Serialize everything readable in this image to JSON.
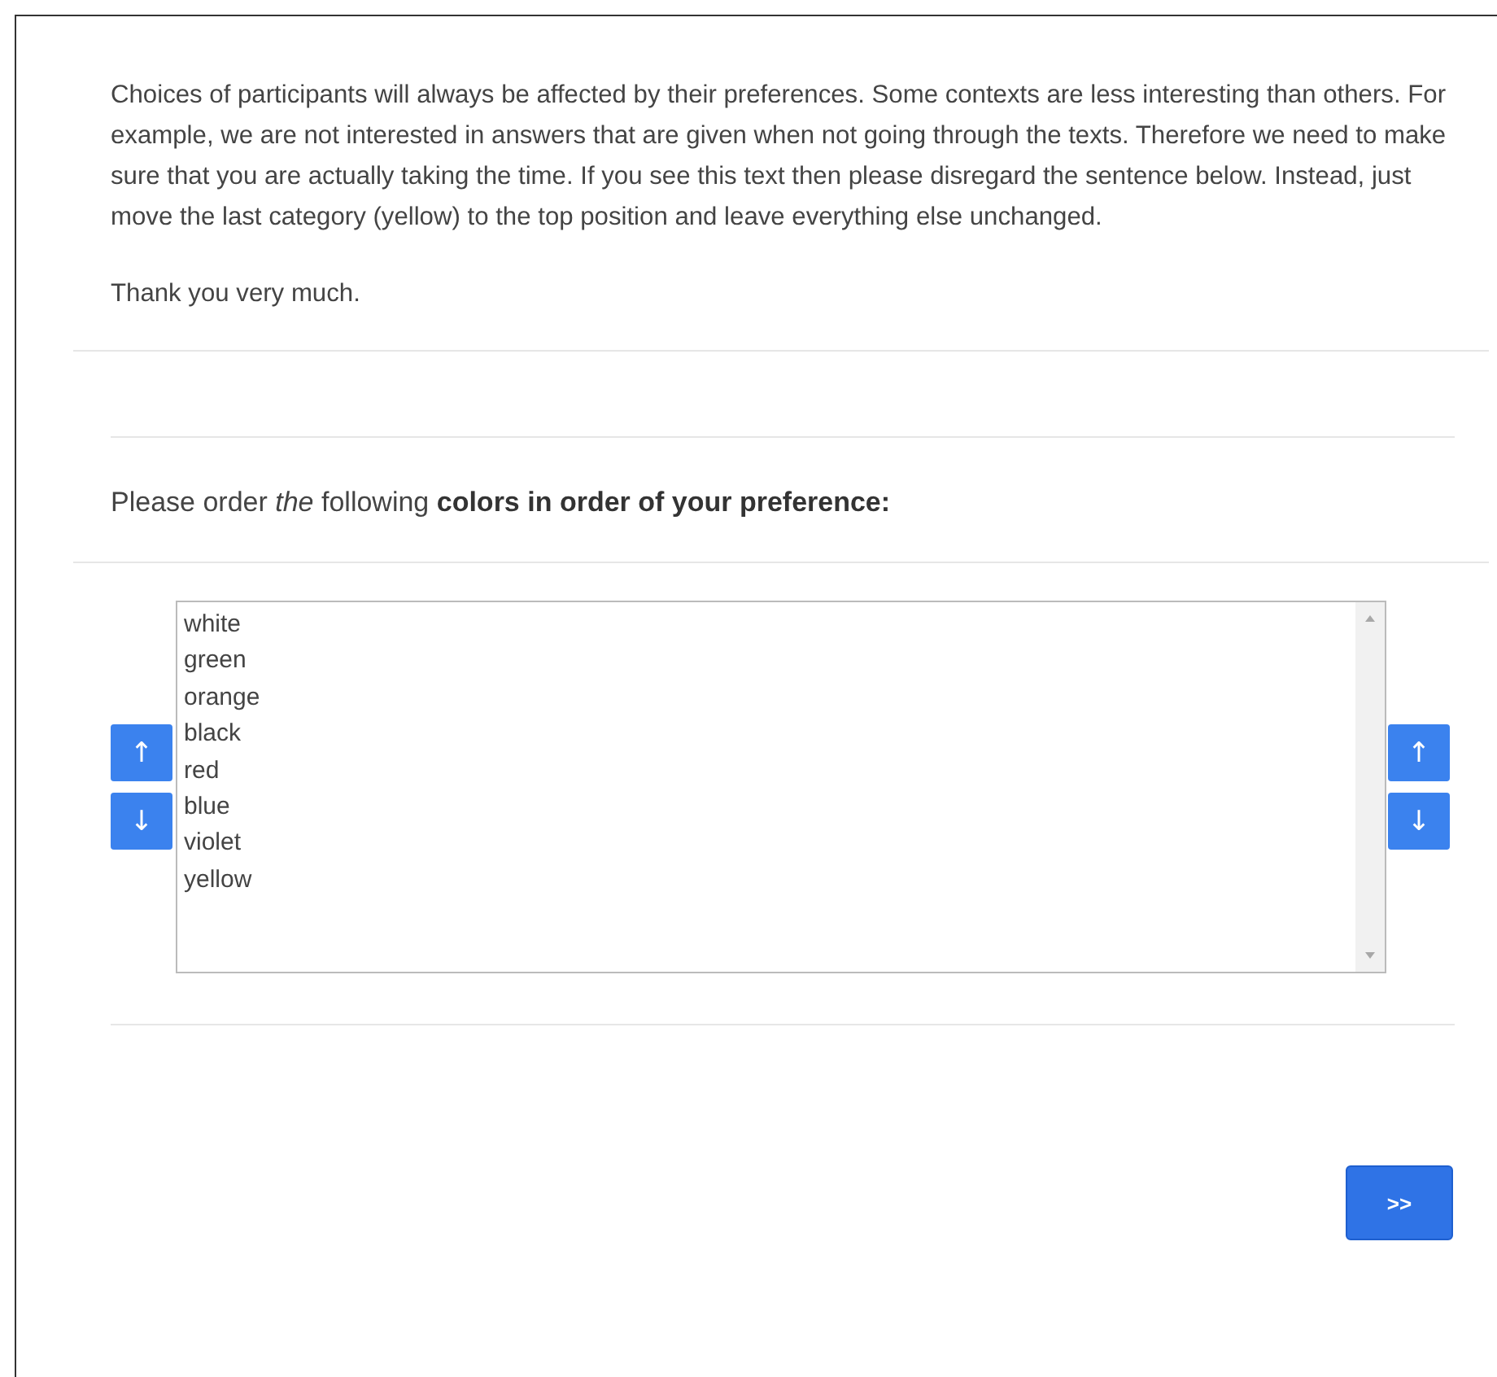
{
  "intro": {
    "paragraphs": [
      "Choices of participants will always be affected by their preferences. Some contexts are less interesting than others. For example, we are not interested in answers that are given when not going through the texts. Therefore we need to make sure that you are actually taking the time. If you see this text then please disregard the sentence below. Instead, just move the last category (yellow) to the top position and leave everything else unchanged.",
      "Thank you very much."
    ]
  },
  "question": {
    "text": "Please order *the* following **colors in order of your preference:**"
  },
  "ranking": {
    "items": [
      "white",
      "green",
      "orange",
      "black",
      "red",
      "blue",
      "violet",
      "yellow"
    ],
    "left_buttons": [
      {
        "label": "↑"
      },
      {
        "label": "↓"
      }
    ],
    "right_buttons": [
      {
        "label": "↑"
      },
      {
        "label": "↓"
      }
    ]
  },
  "next_button": {
    "label": ">>"
  }
}
